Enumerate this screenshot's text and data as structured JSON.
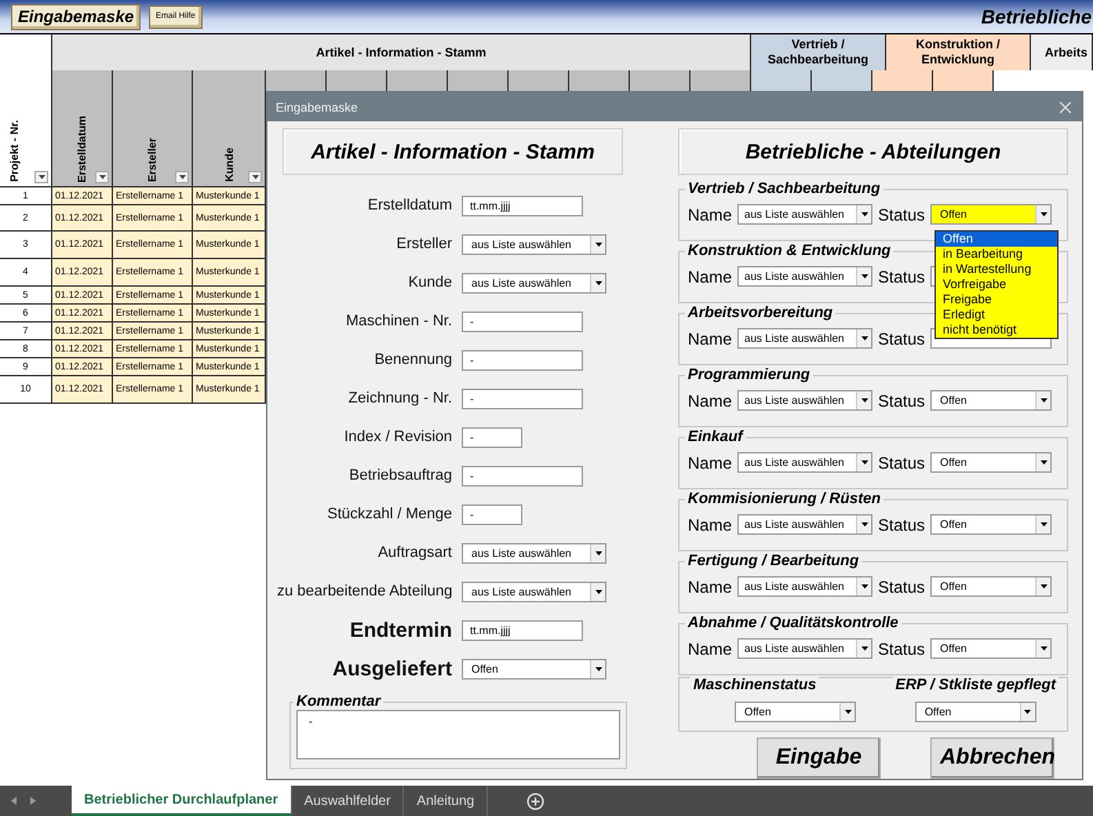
{
  "toolbar": {
    "buttons": [
      {
        "label": "Eingabemaske",
        "kind": "main"
      },
      {
        "label": "Email Hilfe",
        "kind": "small"
      }
    ],
    "title": "Betriebliche"
  },
  "sheet": {
    "corner_header": "Projekt - Nr.",
    "groups": [
      {
        "label": "Artikel - Information - Stamm",
        "color": "#e4e4e4"
      },
      {
        "label": "Vertrieb / Sachbearbeitung",
        "color": "#c9d4e3"
      },
      {
        "label": "Konstruktion / Entwicklung",
        "color": "#fcd9bf"
      },
      {
        "label": "Arbeits",
        "color": "#eeeeee"
      }
    ],
    "columns": [
      "Erstelldatum",
      "Ersteller",
      "Kunde"
    ],
    "rows": [
      {
        "nr": "1",
        "date": "01.12.2021",
        "creator": "Erstellername 1",
        "customer": "Musterkunde 1"
      },
      {
        "nr": "2",
        "date": "01.12.2021",
        "creator": "Erstellername 1",
        "customer": "Musterkunde 1"
      },
      {
        "nr": "3",
        "date": "01.12.2021",
        "creator": "Erstellername 1",
        "customer": "Musterkunde 1"
      },
      {
        "nr": "4",
        "date": "01.12.2021",
        "creator": "Erstellername 1",
        "customer": "Musterkunde 1"
      },
      {
        "nr": "5",
        "date": "01.12.2021",
        "creator": "Erstellername 1",
        "customer": "Musterkunde 1"
      },
      {
        "nr": "6",
        "date": "01.12.2021",
        "creator": "Erstellername 1",
        "customer": "Musterkunde 1"
      },
      {
        "nr": "7",
        "date": "01.12.2021",
        "creator": "Erstellername 1",
        "customer": "Musterkunde 1"
      },
      {
        "nr": "8",
        "date": "01.12.2021",
        "creator": "Erstellername 1",
        "customer": "Musterkunde 1"
      },
      {
        "nr": "9",
        "date": "01.12.2021",
        "creator": "Erstellername 1",
        "customer": "Musterkunde 1"
      },
      {
        "nr": "10",
        "date": "01.12.2021",
        "creator": "Erstellername 1",
        "customer": "Musterkunde 1"
      }
    ]
  },
  "dialog": {
    "title": "Eingabemaske",
    "left_title": "Artikel - Information - Stamm",
    "fields": [
      {
        "label": "Erstelldatum",
        "kind": "text",
        "value": "tt.mm.jjjj",
        "emphasis": false
      },
      {
        "label": "Ersteller",
        "kind": "select",
        "value": "aus Liste auswählen",
        "emphasis": false
      },
      {
        "label": "Kunde",
        "kind": "select",
        "value": "aus Liste auswählen",
        "emphasis": false
      },
      {
        "label": "Maschinen - Nr.",
        "kind": "text",
        "value": "-",
        "emphasis": false
      },
      {
        "label": "Benennung",
        "kind": "text",
        "value": "-",
        "emphasis": false
      },
      {
        "label": "Zeichnung - Nr.",
        "kind": "text",
        "value": "-",
        "emphasis": false
      },
      {
        "label": "Index / Revision",
        "kind": "short-text",
        "value": "-",
        "emphasis": false
      },
      {
        "label": "Betriebsauftrag",
        "kind": "text",
        "value": "-",
        "emphasis": false
      },
      {
        "label": "Stückzahl / Menge",
        "kind": "short-text",
        "value": "-",
        "emphasis": false
      },
      {
        "label": "Auftragsart",
        "kind": "select",
        "value": "aus Liste auswählen",
        "emphasis": false
      },
      {
        "label": "zu bearbeitende Abteilung",
        "kind": "select",
        "value": "aus Liste auswählen",
        "emphasis": false
      },
      {
        "label": "Endtermin",
        "kind": "text",
        "value": "tt.mm.jjjj",
        "emphasis": true
      },
      {
        "label": "Ausgeliefert",
        "kind": "select",
        "value": "Offen",
        "emphasis": true
      }
    ],
    "comment": {
      "title": "Kommentar",
      "value": "-"
    },
    "right_title": "Betriebliche - Abteilungen",
    "departments": [
      {
        "title": "Vertrieb / Sachbearbeitung",
        "name_label": "Name",
        "name_value": "aus Liste auswählen",
        "status_label": "Status",
        "status_value": "Offen",
        "options": [
          {
            "label": "Offen",
            "selected": true
          },
          {
            "label": "in Bearbeitung",
            "selected": false
          },
          {
            "label": "in Wartestellung",
            "selected": false
          },
          {
            "label": "Vorfreigabe",
            "selected": false
          },
          {
            "label": "Freigabe",
            "selected": false
          },
          {
            "label": "Erledigt",
            "selected": false
          },
          {
            "label": "nicht benötigt",
            "selected": false
          }
        ]
      },
      {
        "title": "Konstruktion & Entwicklung",
        "name_label": "Name",
        "name_value": "aus Liste auswählen",
        "status_label": "Status"
      },
      {
        "title": "Arbeitsvorbereitung",
        "name_label": "Name",
        "name_value": "aus Liste auswählen",
        "status_label": "Status"
      },
      {
        "title": "Programmierung",
        "name_label": "Name",
        "name_value": "aus Liste auswählen",
        "status_label": "Status",
        "status_value": "Offen"
      },
      {
        "title": "Einkauf",
        "name_label": "Name",
        "name_value": "aus Liste auswählen",
        "status_label": "Status",
        "status_value": "Offen"
      },
      {
        "title": "Kommisionierung / Rüsten",
        "name_label": "Name",
        "name_value": "aus Liste auswählen",
        "status_label": "Status",
        "status_value": "Offen"
      },
      {
        "title": "Fertigung / Bearbeitung",
        "name_label": "Name",
        "name_value": "aus Liste auswählen",
        "status_label": "Status",
        "status_value": "Offen"
      },
      {
        "title": "Abnahme / Qualitätskontrolle",
        "name_label": "Name",
        "name_value": "aus Liste auswählen",
        "status_label": "Status",
        "status_value": "Offen"
      }
    ],
    "extra": [
      {
        "title": "Maschinenstatus",
        "value": "Offen"
      },
      {
        "title": "ERP / Stkliste gepflegt",
        "value": "Offen"
      }
    ],
    "buttons": [
      "Eingabe",
      "Abbrechen"
    ]
  },
  "sheet_tabs": [
    {
      "label": "Betrieblicher Durchlaufplaner",
      "selected": true
    },
    {
      "label": "Auswahlfelder",
      "selected": false
    },
    {
      "label": "Anleitung",
      "selected": false
    }
  ]
}
